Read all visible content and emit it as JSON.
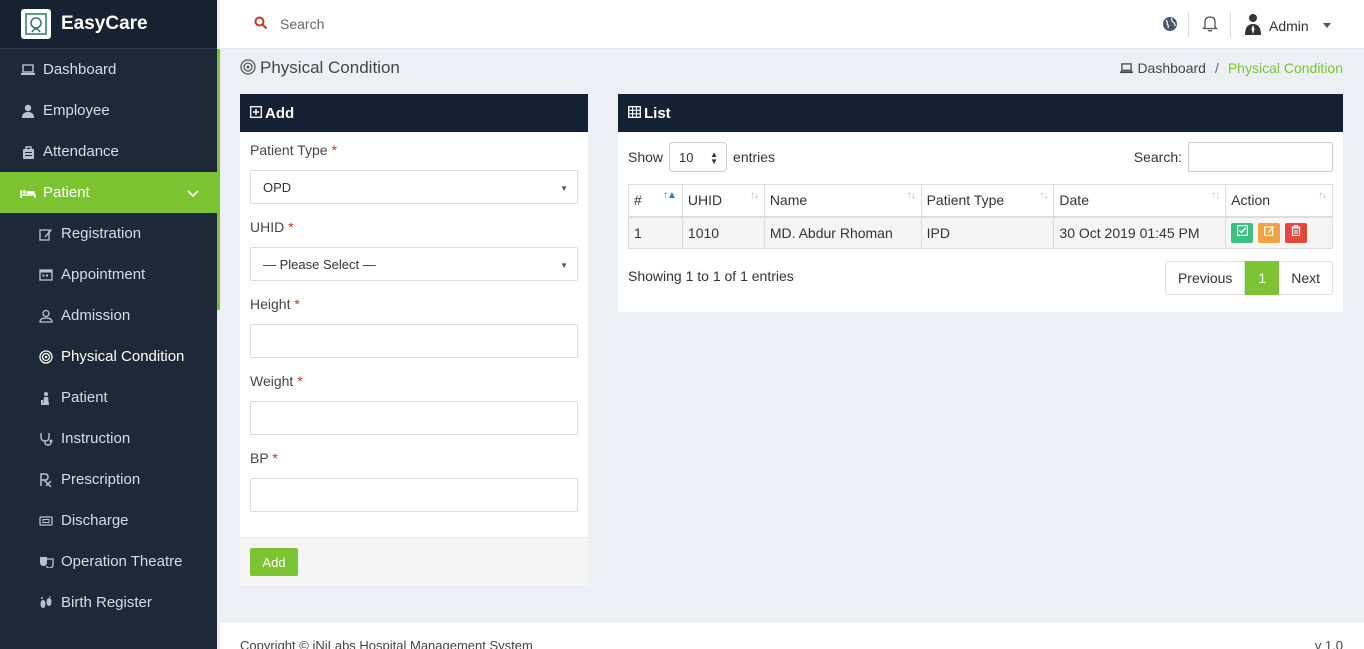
{
  "app": {
    "name": "EasyCare"
  },
  "sidebar": {
    "items": [
      {
        "label": "Dashboard",
        "icon": "laptop-icon"
      },
      {
        "label": "Employee",
        "icon": "user-icon"
      },
      {
        "label": "Attendance",
        "icon": "bag-icon"
      },
      {
        "label": "Patient",
        "icon": "bed-icon"
      }
    ],
    "sub_items": [
      {
        "label": "Registration",
        "icon": "edit-icon"
      },
      {
        "label": "Appointment",
        "icon": "calendar-icon"
      },
      {
        "label": "Admission",
        "icon": "user-check-icon"
      },
      {
        "label": "Physical Condition",
        "icon": "target-icon"
      },
      {
        "label": "Patient",
        "icon": "patient-icon"
      },
      {
        "label": "Instruction",
        "icon": "stethoscope-icon"
      },
      {
        "label": "Prescription",
        "icon": "rx-icon"
      },
      {
        "label": "Discharge",
        "icon": "ticket-icon"
      },
      {
        "label": "Operation Theatre",
        "icon": "theatre-icon"
      },
      {
        "label": "Birth Register",
        "icon": "footprint-icon"
      }
    ]
  },
  "topbar": {
    "search_placeholder": "Search",
    "user_name": "Admin"
  },
  "page": {
    "title": "Physical Condition",
    "breadcrumb_home": "Dashboard",
    "breadcrumb_separator": "/",
    "breadcrumb_current": "Physical Condition"
  },
  "add_form": {
    "heading": "Add",
    "required_mark": "*",
    "patient_type_label": "Patient Type",
    "patient_type_value": "OPD",
    "uhid_label": "UHID",
    "uhid_value": "— Please Select —",
    "height_label": "Height",
    "weight_label": "Weight",
    "bp_label": "BP",
    "submit_label": "Add"
  },
  "list": {
    "heading": "List",
    "show_label": "Show",
    "length_value": "10",
    "entries_label": "entries",
    "search_label": "Search:",
    "columns": [
      "#",
      "UHID",
      "Name",
      "Patient Type",
      "Date",
      "Action"
    ],
    "rows": [
      {
        "num": "1",
        "uhid": "1010",
        "name": "MD. Abdur Rhoman",
        "patient_type": "IPD",
        "date": "30 Oct 2019 01:45 PM"
      }
    ],
    "info": "Showing 1 to 1 of 1 entries",
    "prev_label": "Previous",
    "page_number": "1",
    "next_label": "Next"
  },
  "footer": {
    "copyright": "Copyright © iNiLabs Hospital Management System",
    "version": "v 1.0"
  },
  "colors": {
    "accent": "#7cc332",
    "sidebar_bg": "#1d2939",
    "panel_header": "#142033",
    "action_view": "#3fbf7f",
    "action_edit": "#f0a245",
    "action_delete": "#e8453c"
  }
}
